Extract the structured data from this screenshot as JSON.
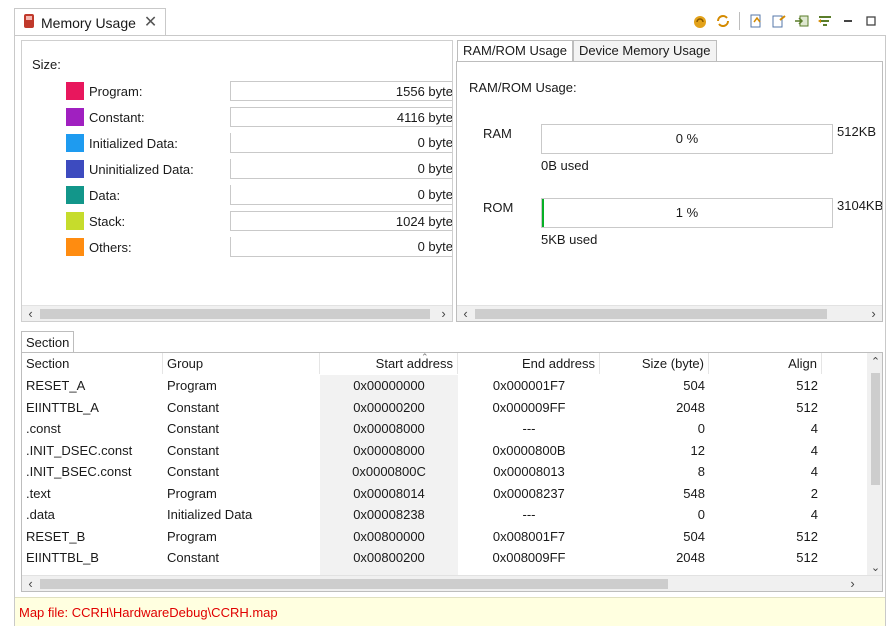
{
  "view": {
    "title": "Memory Usage",
    "close_glyph": "✕",
    "icon": "memory-chip-icon"
  },
  "toolbar": {
    "icons": [
      "refresh-map-icon",
      "sync-icon",
      "export-icon",
      "export-csv-icon",
      "load-icon",
      "filter-icon",
      "minimize-icon",
      "maximize-icon"
    ]
  },
  "size": {
    "heading": "Size:",
    "rows": [
      {
        "label": "Program:",
        "value": "1556 byte",
        "color": "#e8175d"
      },
      {
        "label": "Constant:",
        "value": "4116 byte",
        "color": "#a020c0"
      },
      {
        "label": "Initialized Data:",
        "value": "0 byte",
        "color": "#1e9bf0"
      },
      {
        "label": "Uninitialized Data:",
        "value": "0 byte",
        "color": "#3d4bbf"
      },
      {
        "label": "Data:",
        "value": "0 byte",
        "color": "#12968a"
      },
      {
        "label": "Stack:",
        "value": "1024 byte",
        "color": "#c6dc2c"
      },
      {
        "label": "Others:",
        "value": "0 byte",
        "color": "#ff8c10"
      }
    ]
  },
  "ramrom": {
    "tabs": [
      "RAM/ROM Usage",
      "Device Memory Usage"
    ],
    "heading": "RAM/ROM Usage:",
    "ram": {
      "label": "RAM",
      "percent_text": "0 %",
      "fraction": 0.0,
      "total": "512KB",
      "used": "0B used"
    },
    "rom": {
      "label": "ROM",
      "percent_text": "1 %",
      "fraction": 0.006,
      "total": "3104KB",
      "used": "5KB used"
    }
  },
  "section": {
    "tab_label": "Section",
    "columns": [
      "Section",
      "Group",
      "Start address",
      "End address",
      "Size (byte)",
      "Align"
    ],
    "rows": [
      [
        "RESET_A",
        "Program",
        "0x00000000",
        "0x000001F7",
        "504",
        "512"
      ],
      [
        "EIINTTBL_A",
        "Constant",
        "0x00000200",
        "0x000009FF",
        "2048",
        "512"
      ],
      [
        ".const",
        "Constant",
        "0x00008000",
        "---",
        "0",
        "4"
      ],
      [
        ".INIT_DSEC.const",
        "Constant",
        "0x00008000",
        "0x0000800B",
        "12",
        "4"
      ],
      [
        ".INIT_BSEC.const",
        "Constant",
        "0x0000800C",
        "0x00008013",
        "8",
        "4"
      ],
      [
        ".text",
        "Program",
        "0x00008014",
        "0x00008237",
        "548",
        "2"
      ],
      [
        ".data",
        "Initialized Data",
        "0x00008238",
        "---",
        "0",
        "4"
      ],
      [
        "RESET_B",
        "Program",
        "0x00800000",
        "0x008001F7",
        "504",
        "512"
      ],
      [
        "EIINTTBL_B",
        "Constant",
        "0x00800200",
        "0x008009FF",
        "2048",
        "512"
      ]
    ]
  },
  "status": {
    "map_file": "Map file: CCRH\\HardwareDebug\\CCRH.map"
  }
}
